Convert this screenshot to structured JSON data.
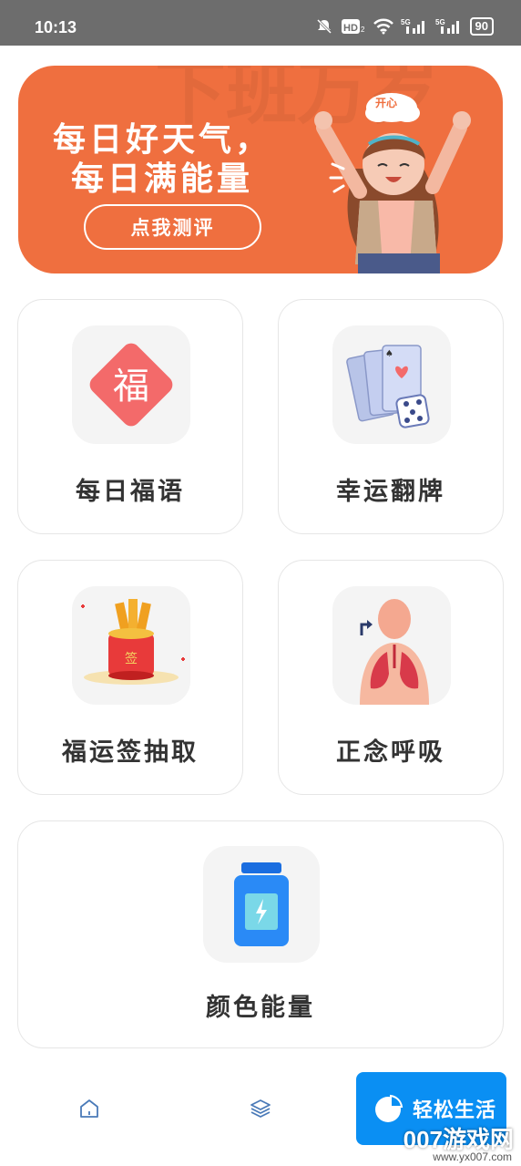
{
  "status_bar": {
    "time": "10:13",
    "battery": "90",
    "icons": [
      "mute-bell-icon",
      "hd-icon",
      "wifi-icon",
      "signal-5g-icon",
      "signal-5g-icon",
      "battery-icon"
    ]
  },
  "banner": {
    "line1": "每日好天气，",
    "line2": "每日满能量",
    "button_label": "点我测评",
    "bubble": "开心",
    "watermark": "下班万岁",
    "color": "#ef6f3f"
  },
  "cards": [
    {
      "label": "每日福语",
      "icon": "fortune-diamond-icon"
    },
    {
      "label": "幸运翻牌",
      "icon": "playing-cards-dice-icon"
    },
    {
      "label": "福运签抽取",
      "icon": "fortune-sticks-icon"
    },
    {
      "label": "正念呼吸",
      "icon": "breathing-lungs-icon"
    },
    {
      "label": "颜色能量",
      "icon": "energy-bottle-icon"
    }
  ],
  "fortune_char": "福",
  "sticks_char": "签",
  "bottom_nav": {
    "items": [
      {
        "icon": "home-icon"
      },
      {
        "icon": "layers-icon"
      }
    ],
    "fab_label": "轻松生活",
    "fab_icon": "pie-chart-icon",
    "accent": "#0a8ff3"
  },
  "watermark": {
    "site": "007游戏网",
    "url": "www.yx007.com"
  }
}
